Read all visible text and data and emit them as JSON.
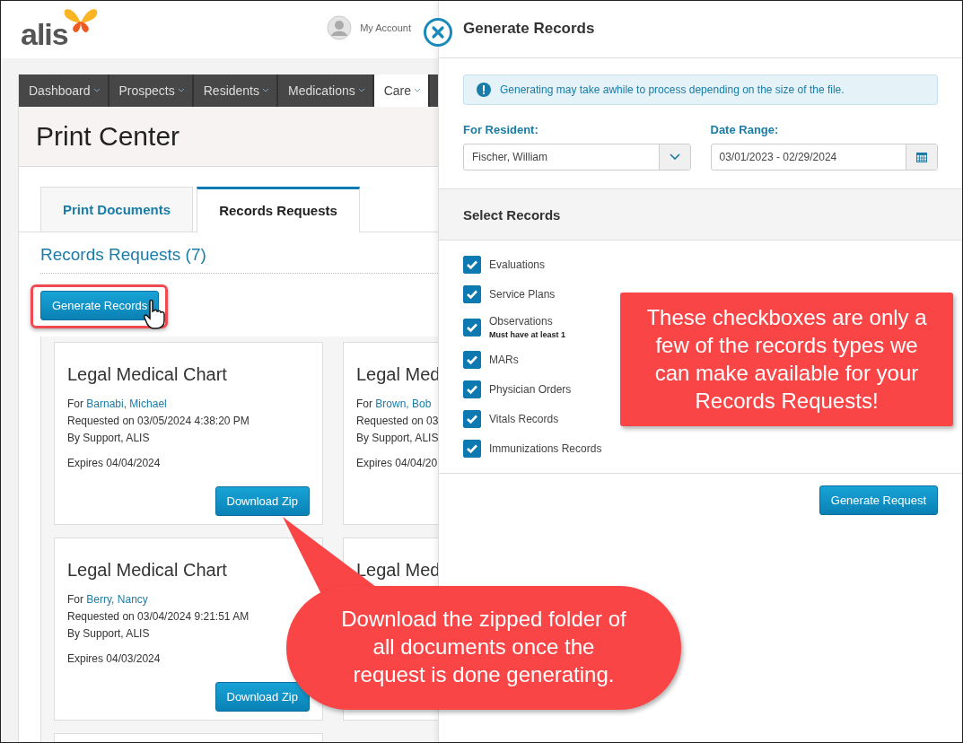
{
  "header": {
    "logo": "alis",
    "account": "My Account"
  },
  "nav": [
    {
      "label": "Dashboard",
      "selected": false
    },
    {
      "label": "Prospects",
      "selected": false
    },
    {
      "label": "Residents",
      "selected": false
    },
    {
      "label": "Medications",
      "selected": false
    },
    {
      "label": "Care",
      "selected": true
    }
  ],
  "page_title": "Print Center",
  "tabs": [
    {
      "label": "Print Documents",
      "selected": false
    },
    {
      "label": "Records Requests",
      "selected": true
    }
  ],
  "section_title": "Records Requests (7)",
  "generate_button": "Generate Records",
  "cards": [
    {
      "title": "Legal Medical Chart",
      "for": "For",
      "resident": "Barnabi, Michael",
      "requested": "Requested on 03/05/2024 4:38:20 PM",
      "by": "By Support, ALIS",
      "expires": "Expires 04/04/2024",
      "button": "Download Zip"
    },
    {
      "title": "Legal Med",
      "for": "For",
      "resident": "Brown, Bob",
      "requested": "Requested on 03",
      "by": "By Support, ALIS",
      "expires": "Expires 04/04/20"
    },
    {
      "title": "Legal Medical Chart",
      "for": "For",
      "resident": "Berry, Nancy",
      "requested": "Requested on 03/04/2024 9:21:51 AM",
      "by": "By Support, ALIS",
      "expires": "Expires 04/03/2024",
      "button": "Download Zip"
    },
    {
      "title": "Legal Med"
    }
  ],
  "drawer": {
    "title": "Generate Records",
    "alert": "Generating may take awhile to process depending on the size of the file.",
    "resident_label": "For Resident:",
    "resident_value": "Fischer, William",
    "date_label": "Date Range:",
    "date_value": "03/01/2023 - 02/29/2024",
    "records_heading": "Select Records",
    "records": [
      {
        "label": "Evaluations",
        "checked": true
      },
      {
        "label": "Service Plans",
        "checked": true
      },
      {
        "label": "Observations",
        "note": "Must have at least 1",
        "checked": true
      },
      {
        "label": "MARs",
        "checked": true
      },
      {
        "label": "Physician Orders",
        "checked": true
      },
      {
        "label": "Vitals Records",
        "checked": true
      },
      {
        "label": "Immunizations Records",
        "checked": true
      }
    ],
    "submit": "Generate Request"
  },
  "callouts": [
    {
      "kind": "box",
      "text": "These checkboxes are only a few of the records types we can make available for your Records Requests!"
    },
    {
      "kind": "bubble",
      "text": "Download the zipped folder of all documents once the request is done generating."
    }
  ]
}
